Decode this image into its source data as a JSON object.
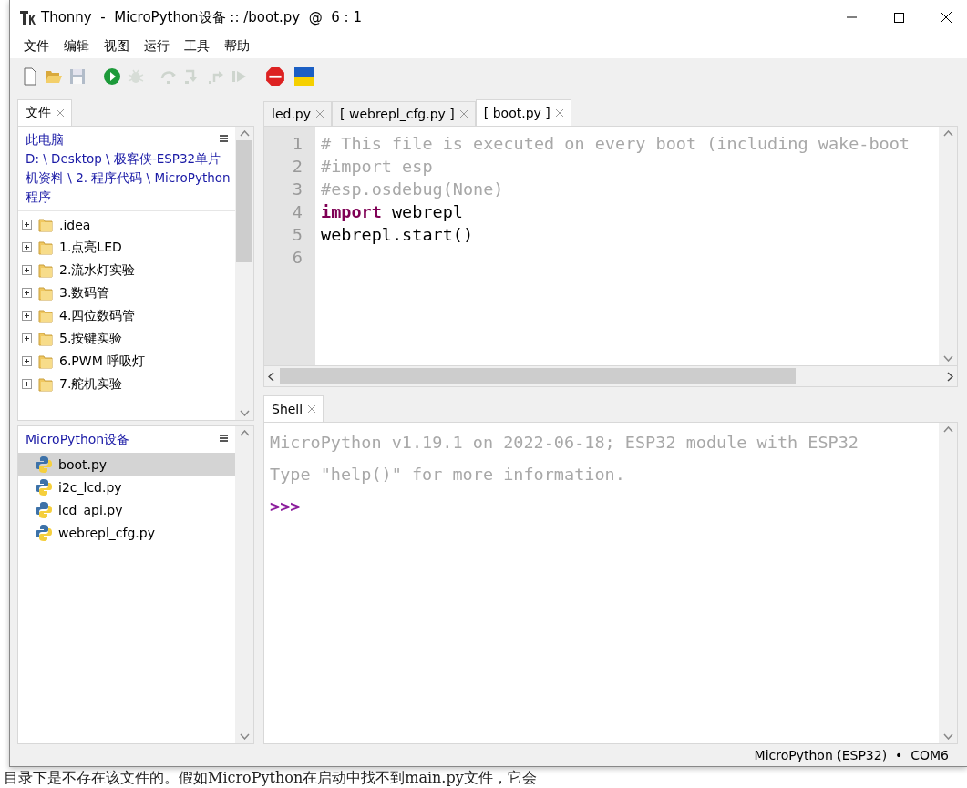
{
  "window": {
    "title": "Thonny  -  MicroPython设备 :: /boot.py  @  6 : 1"
  },
  "menu": [
    "文件",
    "编辑",
    "视图",
    "运行",
    "工具",
    "帮助"
  ],
  "toolbar": [
    {
      "kind": "new",
      "disabled": false
    },
    {
      "kind": "open",
      "disabled": false
    },
    {
      "kind": "save",
      "disabled": true
    },
    {
      "kind": "run",
      "disabled": false
    },
    {
      "kind": "debug",
      "disabled": true
    },
    {
      "kind": "step-over",
      "disabled": true
    },
    {
      "kind": "step-into",
      "disabled": true
    },
    {
      "kind": "step-out",
      "disabled": true
    },
    {
      "kind": "resume",
      "disabled": true
    },
    {
      "kind": "stop",
      "disabled": false
    },
    {
      "kind": "flag",
      "disabled": false
    }
  ],
  "files_panel": {
    "tab": "文件",
    "location": "此电脑",
    "path": "D: \\ Desktop \\ 极客侠-ESP32单片机资料 \\ 2. 程序代码 \\ MicroPython程序",
    "items": [
      {
        "label": ".idea",
        "expanded": false
      },
      {
        "label": "1.点亮LED",
        "expanded": false
      },
      {
        "label": "2.流水灯实验",
        "expanded": false
      },
      {
        "label": "3.数码管",
        "expanded": false
      },
      {
        "label": "4.四位数码管",
        "expanded": false
      },
      {
        "label": "5.按键实验",
        "expanded": false
      },
      {
        "label": "6.PWM 呼吸灯",
        "expanded": false
      },
      {
        "label": "7.舵机实验",
        "expanded": false
      }
    ]
  },
  "device_panel": {
    "title": "MicroPython设备",
    "files": [
      {
        "label": "boot.py",
        "selected": true
      },
      {
        "label": "i2c_lcd.py",
        "selected": false
      },
      {
        "label": "lcd_api.py",
        "selected": false
      },
      {
        "label": "webrepl_cfg.py",
        "selected": false
      }
    ]
  },
  "editor": {
    "tabs": [
      {
        "label": "led.py",
        "selected": false
      },
      {
        "label": "[ webrepl_cfg.py ]",
        "selected": false
      },
      {
        "label": "[ boot.py ]",
        "selected": true
      }
    ],
    "lines": [
      {
        "number": "1",
        "tokens": [
          {
            "text": "# This file is executed on every boot (including wake-boot",
            "kind": "comment"
          }
        ]
      },
      {
        "number": "2",
        "tokens": [
          {
            "text": "#import esp",
            "kind": "comment"
          }
        ]
      },
      {
        "number": "3",
        "tokens": [
          {
            "text": "#esp.osdebug(None)",
            "kind": "comment"
          }
        ]
      },
      {
        "number": "4",
        "tokens": [
          {
            "text": "import",
            "kind": "keyword"
          },
          {
            "text": " webrepl",
            "kind": "plain"
          }
        ]
      },
      {
        "number": "5",
        "tokens": [
          {
            "text": "webrepl.start()",
            "kind": "plain"
          }
        ]
      },
      {
        "number": "6"
      }
    ]
  },
  "shell": {
    "tab": "Shell",
    "lines": [
      {
        "text": "MicroPython v1.19.1 on 2022-06-18; ESP32 module with ESP32",
        "kind": "output"
      },
      {
        "text": "Type \"help()\" for more information.",
        "kind": "output"
      },
      {
        "text": ">>>",
        "kind": "prompt"
      }
    ]
  },
  "status_bar": "MicroPython (ESP32)  •  COM6",
  "background_text": "目录下是不存在该文件的。假如MicroPython在启动中找不到main.py文件，它会"
}
